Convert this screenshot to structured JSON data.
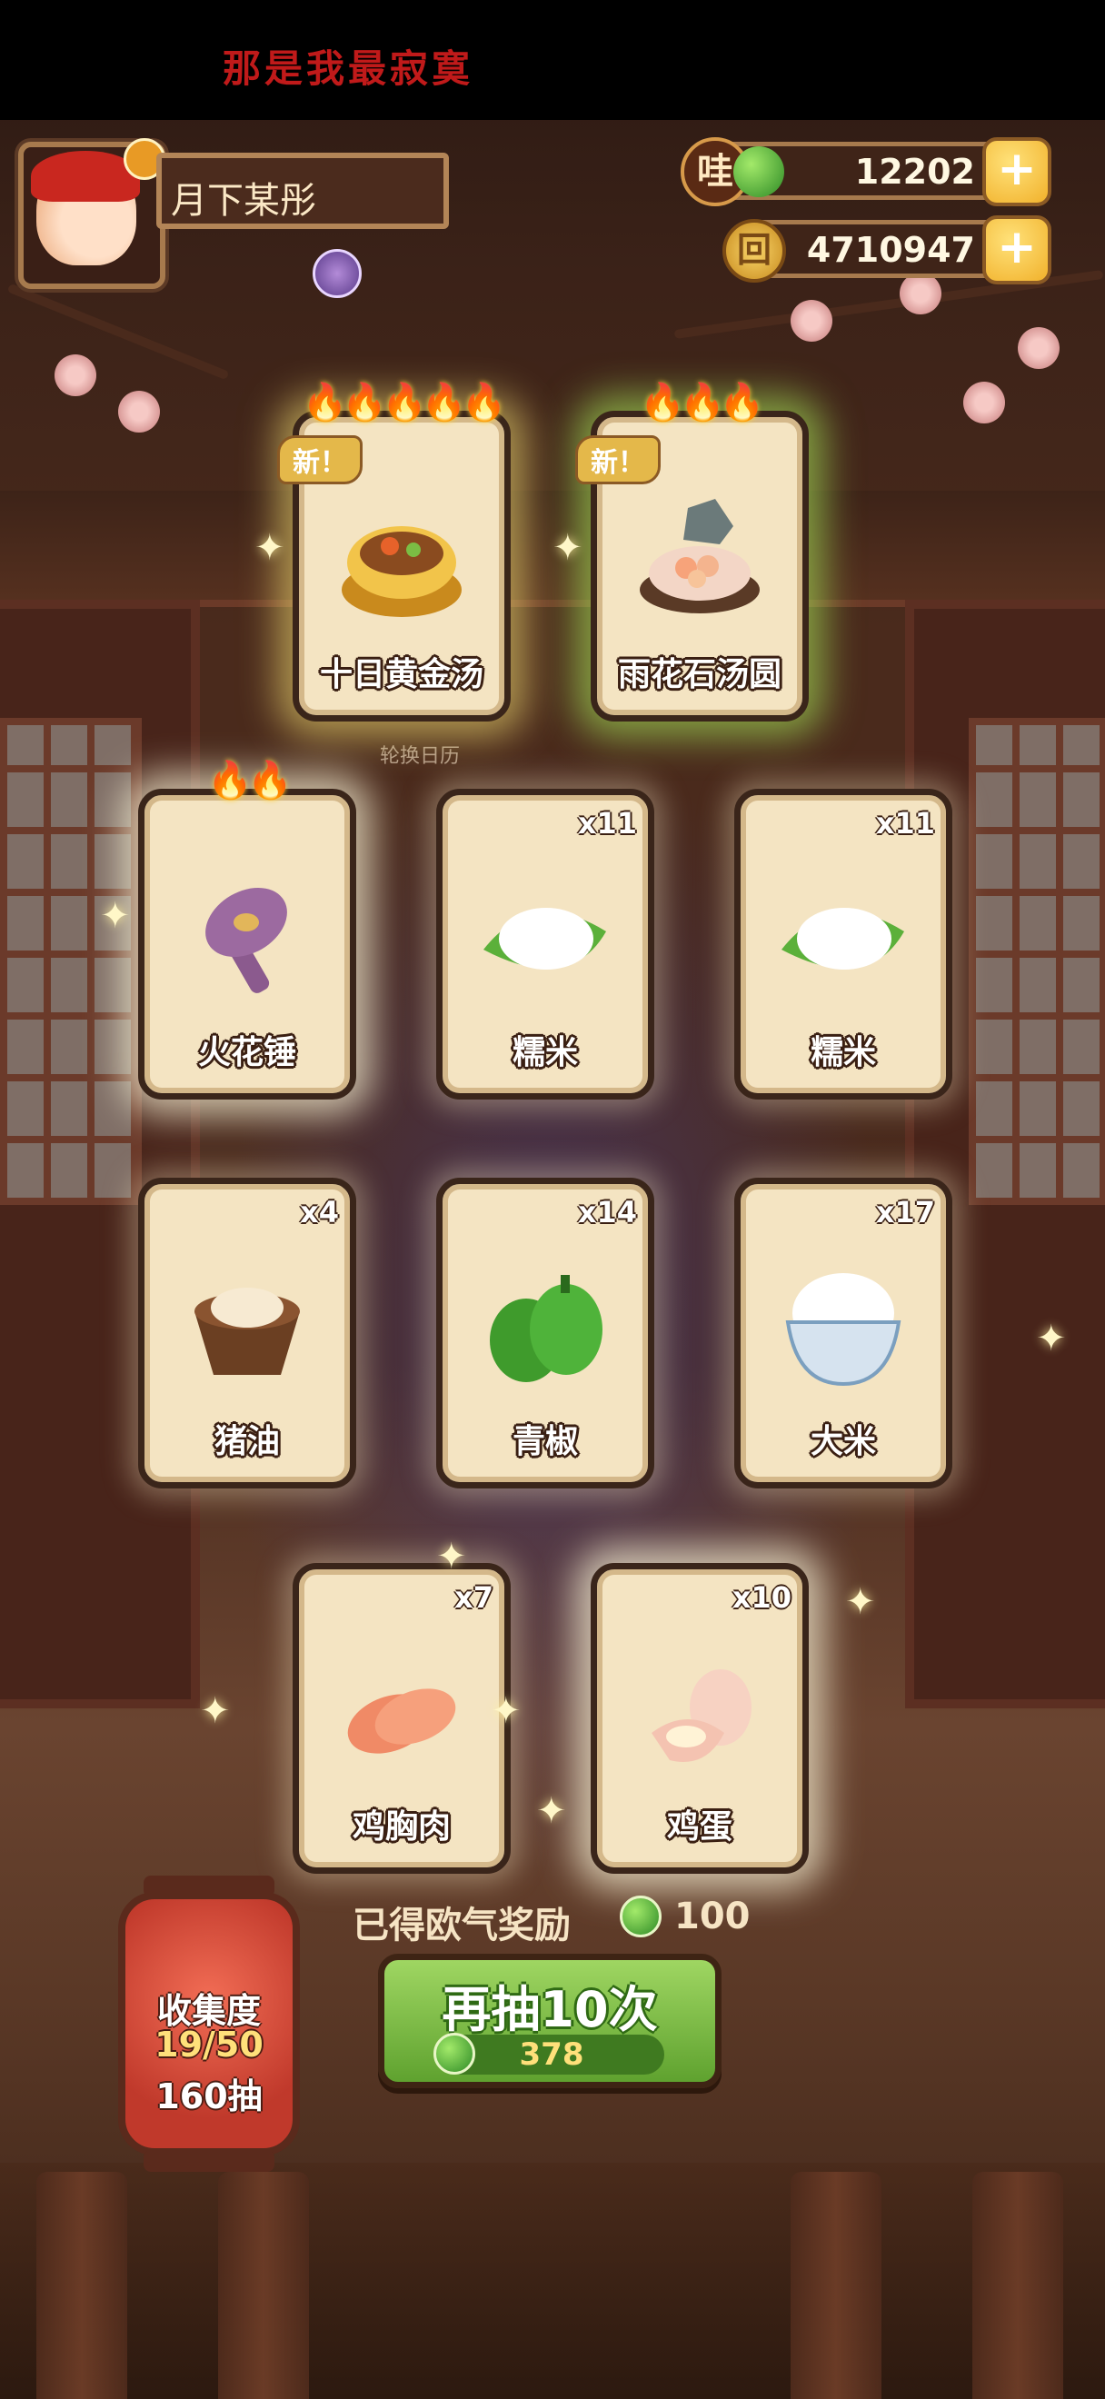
{
  "banner": "那是我最寂寞",
  "player": {
    "name": "月下某彤"
  },
  "currencies": {
    "jade": {
      "badge": "哇",
      "value": "12202",
      "plus": "+"
    },
    "gold": {
      "badge": "回",
      "value": "4710947",
      "plus": "+"
    }
  },
  "rotation_label": "轮换日历",
  "new_label": "新！",
  "cards": [
    {
      "name": "十日黄金汤",
      "qty": "",
      "new": true,
      "flames": "🔥🔥🔥🔥🔥"
    },
    {
      "name": "雨花石汤圆",
      "qty": "",
      "new": true,
      "flames": "🔥🔥🔥"
    },
    {
      "name": "火花锤",
      "qty": "",
      "new": false,
      "flames": "🔥🔥"
    },
    {
      "name": "糯米",
      "qty": "x11",
      "new": false,
      "flames": ""
    },
    {
      "name": "糯米",
      "qty": "x11",
      "new": false,
      "flames": ""
    },
    {
      "name": "猪油",
      "qty": "x4",
      "new": false,
      "flames": ""
    },
    {
      "name": "青椒",
      "qty": "x14",
      "new": false,
      "flames": ""
    },
    {
      "name": "大米",
      "qty": "x17",
      "new": false,
      "flames": ""
    },
    {
      "name": "鸡胸肉",
      "qty": "x7",
      "new": false,
      "flames": ""
    },
    {
      "name": "鸡蛋",
      "qty": "x10",
      "new": false,
      "flames": ""
    }
  ],
  "collection": {
    "label": "收集度",
    "progress": "19/50",
    "draws": "160抽"
  },
  "reward": {
    "label": "已得欧气奖励",
    "value": "100"
  },
  "draw_button": {
    "label": "再抽10次",
    "cost": "378"
  },
  "colors": {
    "accent_green": "#7cc043",
    "gold": "#f1b12b",
    "card_bg": "#f4e4c2",
    "banner_red": "#c01a1a"
  }
}
